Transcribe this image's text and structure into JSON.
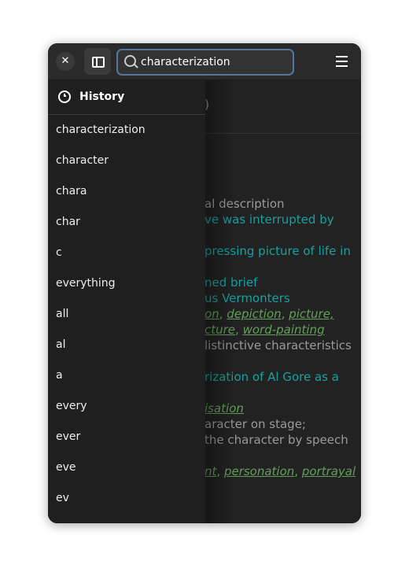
{
  "search": {
    "value": "characterization"
  },
  "sidebar": {
    "title": "History",
    "items": [
      "characterization",
      "character",
      "chara",
      "char",
      "c",
      "everything",
      "all",
      "al",
      "a",
      "every",
      "ever",
      "eve",
      "ev"
    ]
  },
  "content": {
    "heading_fragment": "o)",
    "lines": [
      {
        "text": "al description",
        "style": "gray"
      },
      {
        "text": "ve was interrupted by",
        "style": "teal"
      },
      {
        "text": "pressing picture of life in",
        "style": "teal"
      },
      {
        "text": "ned brief",
        "style": "teal"
      },
      {
        "text": "us Vermonters",
        "style": "teal"
      },
      {
        "text": "on, depiction, picture,",
        "style": "green"
      },
      {
        "text": "cture, word-painting",
        "style": "green"
      },
      {
        "text": "listinctive characteristics",
        "style": "gray"
      },
      {
        "text": "rization of Al Gore as a",
        "style": "teal"
      },
      {
        "text": "isation",
        "style": "green"
      },
      {
        "text": "aracter on stage;",
        "style": "gray"
      },
      {
        "text": " the character by speech",
        "style": "gray"
      },
      {
        "text": "nt, personation, portrayal",
        "style": "green"
      }
    ]
  },
  "colors": {
    "accent": "#56759a",
    "teal": "#19a0a0",
    "green": "#62a05a"
  }
}
